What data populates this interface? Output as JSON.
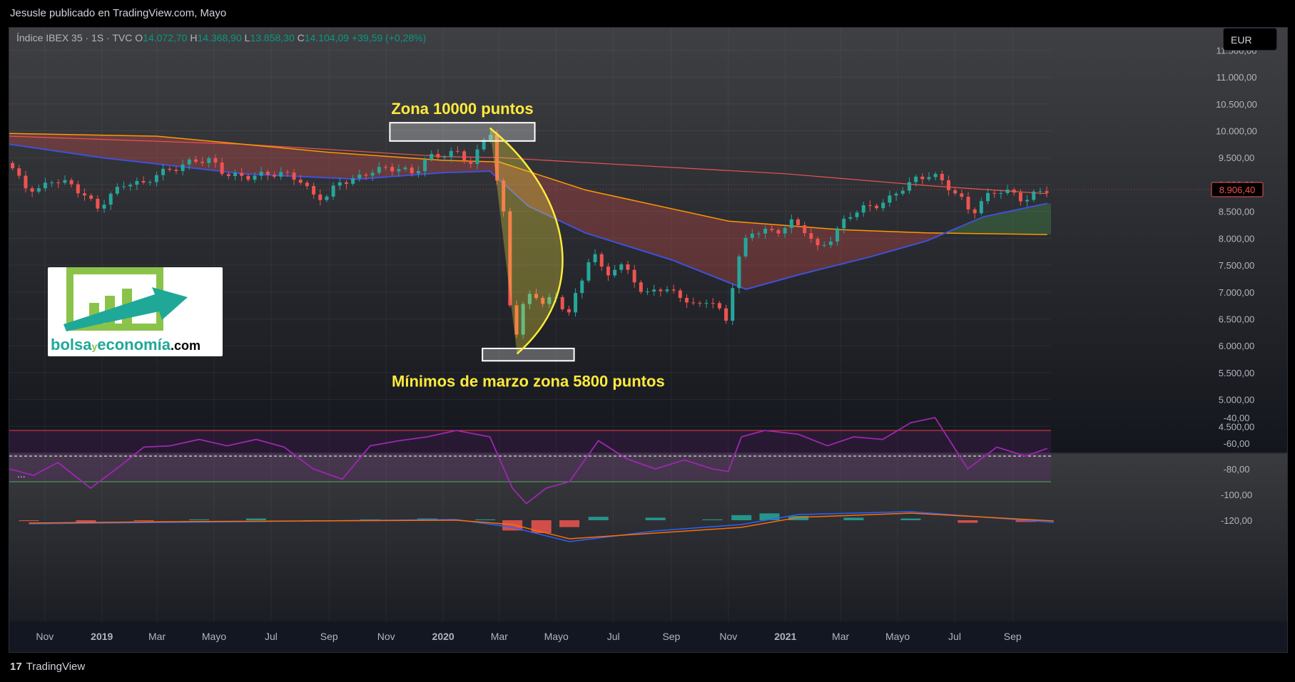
{
  "header": {
    "attribution": "Jesusle publicado en TradingView.com, Mayo"
  },
  "legend": {
    "symbol": "Índice IBEX 35 · 1S · TVC",
    "o_label": "O",
    "o_value": "14.072,70",
    "h_label": "H",
    "h_value": "14.368,90",
    "l_label": "L",
    "l_value": "13.858,30",
    "c_label": "C",
    "c_value": "14.104,09",
    "change": "+39,59 (+0,28%)"
  },
  "currency": "EUR",
  "indicator_pane_label": "...",
  "footer": {
    "brand": "TradingView",
    "brand_icon": "tradingview-logo-icon"
  },
  "logo": {
    "text_main": "bolsa",
    "text_y": "y",
    "text_econ": "economía",
    "text_com": ".com",
    "icon": "rising-chart-arrow-icon"
  },
  "colors": {
    "bg_top": "#3f4043",
    "bg_bottom": "#131722",
    "up": "#26a69a",
    "down": "#ef5350",
    "sma_red": "#ef5350",
    "sma_orange": "#ff9800",
    "ema_blue": "#3f51d8",
    "annotation": "#ffeb3b",
    "rsi": "#9c27b0",
    "macd_line": "#2962ff",
    "signal_line": "#ff6d00"
  },
  "chart_data": {
    "type": "candlestick",
    "price_axis": {
      "ticks": [
        "11.500,00",
        "11.000,00",
        "10.500,00",
        "10.000,00",
        "9.500,00",
        "9.000,00",
        "8.500,00",
        "8.000,00",
        "7.500,00",
        "7.000,00",
        "6.500,00",
        "6.000,00",
        "5.500,00",
        "5.000,00",
        "4.500,00"
      ],
      "tick_values": [
        11500,
        11000,
        10500,
        10000,
        9500,
        9000,
        8500,
        8000,
        7500,
        7000,
        6500,
        6000,
        5500,
        5000,
        4500
      ],
      "last_price_label": "8.906,40",
      "last_price": 8906.4
    },
    "time_axis": {
      "labels": [
        "Nov",
        "2019",
        "Mar",
        "Mayo",
        "Jul",
        "Sep",
        "Nov",
        "2020",
        "Mar",
        "Mayo",
        "Jul",
        "Sep",
        "Nov",
        "2021",
        "Mar",
        "Mayo",
        "Jul",
        "Sep"
      ],
      "bold": [
        false,
        true,
        false,
        false,
        false,
        false,
        false,
        true,
        false,
        false,
        false,
        false,
        false,
        true,
        false,
        false,
        false,
        false
      ],
      "months": [
        "2018-11",
        "2019-01",
        "2019-03",
        "2019-05",
        "2019-07",
        "2019-09",
        "2019-11",
        "2020-01",
        "2020-03",
        "2020-05",
        "2020-07",
        "2020-09",
        "2020-11",
        "2021-01",
        "2021-03",
        "2021-05",
        "2021-07",
        "2021-09"
      ]
    },
    "close_path": [
      [
        "2018-09-24",
        9400
      ],
      [
        "2018-10-10",
        8950
      ],
      [
        "2018-10-26",
        8900
      ],
      [
        "2018-11-10",
        9100
      ],
      [
        "2018-11-28",
        9000
      ],
      [
        "2018-12-14",
        8800
      ],
      [
        "2018-12-27",
        8550
      ],
      [
        "2019-01-10",
        8800
      ],
      [
        "2019-01-28",
        9050
      ],
      [
        "2019-02-14",
        9000
      ],
      [
        "2019-03-01",
        9200
      ],
      [
        "2019-03-20",
        9300
      ],
      [
        "2019-04-10",
        9450
      ],
      [
        "2019-04-28",
        9450
      ],
      [
        "2019-05-12",
        9200
      ],
      [
        "2019-05-26",
        9150
      ],
      [
        "2019-06-10",
        9150
      ],
      [
        "2019-06-28",
        9200
      ],
      [
        "2019-07-15",
        9200
      ],
      [
        "2019-07-31",
        9100
      ],
      [
        "2019-08-14",
        8800
      ],
      [
        "2019-08-28",
        8750
      ],
      [
        "2019-09-12",
        9050
      ],
      [
        "2019-09-30",
        9100
      ],
      [
        "2019-10-15",
        9250
      ],
      [
        "2019-10-31",
        9300
      ],
      [
        "2019-11-15",
        9300
      ],
      [
        "2019-11-30",
        9200
      ],
      [
        "2019-12-15",
        9500
      ],
      [
        "2019-12-31",
        9550
      ],
      [
        "2020-01-15",
        9600
      ],
      [
        "2020-01-31",
        9400
      ],
      [
        "2020-02-10",
        9700
      ],
      [
        "2020-02-20",
        10050
      ],
      [
        "2020-02-28",
        9000
      ],
      [
        "2020-03-06",
        8400
      ],
      [
        "2020-03-13",
        6650
      ],
      [
        "2020-03-20",
        6230
      ],
      [
        "2020-03-27",
        6780
      ],
      [
        "2020-04-06",
        7000
      ],
      [
        "2020-04-17",
        6800
      ],
      [
        "2020-04-30",
        6900
      ],
      [
        "2020-05-14",
        6600
      ],
      [
        "2020-05-28",
        7200
      ],
      [
        "2020-06-08",
        7800
      ],
      [
        "2020-06-22",
        7300
      ],
      [
        "2020-07-06",
        7500
      ],
      [
        "2020-07-20",
        7350
      ],
      [
        "2020-08-03",
        6900
      ],
      [
        "2020-08-17",
        7100
      ],
      [
        "2020-08-31",
        7000
      ],
      [
        "2020-09-14",
        6900
      ],
      [
        "2020-09-28",
        6700
      ],
      [
        "2020-10-12",
        6900
      ],
      [
        "2020-10-30",
        6450
      ],
      [
        "2020-11-09",
        7500
      ],
      [
        "2020-11-23",
        8100
      ],
      [
        "2020-12-07",
        8150
      ],
      [
        "2020-12-21",
        8100
      ],
      [
        "2021-01-08",
        8300
      ],
      [
        "2021-01-22",
        8150
      ],
      [
        "2021-02-05",
        7800
      ],
      [
        "2021-02-19",
        8000
      ],
      [
        "2021-03-08",
        8400
      ],
      [
        "2021-03-22",
        8550
      ],
      [
        "2021-04-06",
        8600
      ],
      [
        "2021-04-20",
        8700
      ],
      [
        "2021-05-07",
        8950
      ],
      [
        "2021-05-21",
        9100
      ],
      [
        "2021-06-07",
        9200
      ],
      [
        "2021-06-21",
        9000
      ],
      [
        "2021-07-05",
        8800
      ],
      [
        "2021-07-19",
        8450
      ],
      [
        "2021-08-02",
        8750
      ],
      [
        "2021-08-16",
        8900
      ],
      [
        "2021-08-30",
        8850
      ],
      [
        "2021-09-13",
        8700
      ],
      [
        "2021-09-27",
        8850
      ],
      [
        "2021-10-08",
        8906.4
      ]
    ],
    "overlays": [
      {
        "name": "SMA 200 (red)",
        "points": [
          [
            "2018-09-24",
            9900
          ],
          [
            "2019-06-01",
            9750
          ],
          [
            "2020-01-01",
            9520
          ],
          [
            "2020-03-01",
            9500
          ],
          [
            "2020-07-01",
            9380
          ],
          [
            "2021-01-01",
            9200
          ],
          [
            "2021-06-01",
            8980
          ],
          [
            "2021-10-08",
            8830
          ]
        ]
      },
      {
        "name": "SMA (orange)",
        "points": [
          [
            "2018-09-24",
            9950
          ],
          [
            "2019-03-01",
            9900
          ],
          [
            "2019-09-01",
            9600
          ],
          [
            "2020-01-01",
            9450
          ],
          [
            "2020-03-01",
            9420
          ],
          [
            "2020-06-01",
            8900
          ],
          [
            "2020-11-01",
            8320
          ],
          [
            "2021-03-01",
            8160
          ],
          [
            "2021-06-01",
            8100
          ],
          [
            "2021-10-08",
            8070
          ]
        ]
      },
      {
        "name": "EMA (blue)",
        "points": [
          [
            "2018-09-24",
            9750
          ],
          [
            "2019-01-01",
            9500
          ],
          [
            "2019-06-01",
            9200
          ],
          [
            "2019-10-01",
            9100
          ],
          [
            "2020-01-01",
            9220
          ],
          [
            "2020-02-20",
            9250
          ],
          [
            "2020-04-01",
            8600
          ],
          [
            "2020-06-01",
            8100
          ],
          [
            "2020-09-01",
            7600
          ],
          [
            "2020-11-20",
            7050
          ],
          [
            "2021-01-15",
            7320
          ],
          [
            "2021-04-01",
            7650
          ],
          [
            "2021-06-01",
            7950
          ],
          [
            "2021-08-01",
            8400
          ],
          [
            "2021-10-08",
            8650
          ]
        ]
      }
    ],
    "annotations": [
      {
        "text": "Zona 10000 puntos",
        "box_price": [
          10150,
          9810
        ],
        "box_dates": [
          "2019-11-05",
          "2020-04-08"
        ]
      },
      {
        "text": "Mínimos de marzo zona 5800 puntos",
        "box_price": [
          5950,
          5720
        ],
        "box_dates": [
          "2020-02-12",
          "2020-05-20"
        ]
      }
    ],
    "rsi": {
      "axis_ticks": [
        "-40,00",
        "-60,00",
        "-80,00",
        "-100,00",
        "-120,00"
      ],
      "tick_values": [
        -40,
        -60,
        -80,
        -100,
        -120
      ],
      "upper_band": -50,
      "lower_band": -90,
      "mid": -70,
      "series": [
        [
          "2018-09-24",
          -80
        ],
        [
          "2018-10-20",
          -85
        ],
        [
          "2018-11-15",
          -75
        ],
        [
          "2018-12-20",
          -95
        ],
        [
          "2019-01-20",
          -78
        ],
        [
          "2019-02-15",
          -63
        ],
        [
          "2019-03-15",
          -62
        ],
        [
          "2019-04-15",
          -57
        ],
        [
          "2019-05-15",
          -62
        ],
        [
          "2019-06-15",
          -57
        ],
        [
          "2019-07-15",
          -63
        ],
        [
          "2019-08-15",
          -80
        ],
        [
          "2019-09-15",
          -88
        ],
        [
          "2019-10-15",
          -62
        ],
        [
          "2019-11-15",
          -58
        ],
        [
          "2019-12-15",
          -55
        ],
        [
          "2020-01-15",
          -50
        ],
        [
          "2020-02-20",
          -55
        ],
        [
          "2020-03-15",
          -95
        ],
        [
          "2020-03-30",
          -107
        ],
        [
          "2020-04-20",
          -95
        ],
        [
          "2020-05-15",
          -90
        ],
        [
          "2020-06-15",
          -58
        ],
        [
          "2020-07-15",
          -72
        ],
        [
          "2020-08-15",
          -80
        ],
        [
          "2020-09-15",
          -73
        ],
        [
          "2020-10-15",
          -80
        ],
        [
          "2020-11-01",
          -82
        ],
        [
          "2020-11-15",
          -55
        ],
        [
          "2020-12-10",
          -50
        ],
        [
          "2021-01-15",
          -53
        ],
        [
          "2021-02-15",
          -62
        ],
        [
          "2021-03-15",
          -55
        ],
        [
          "2021-04-15",
          -57
        ],
        [
          "2021-05-15",
          -44
        ],
        [
          "2021-06-10",
          -40
        ],
        [
          "2021-07-15",
          -80
        ],
        [
          "2021-08-15",
          -63
        ],
        [
          "2021-09-15",
          -70
        ],
        [
          "2021-10-08",
          -64
        ]
      ]
    },
    "macd": {
      "histogram": [
        [
          "2018-10",
          -1
        ],
        [
          "2018-12",
          -2
        ],
        [
          "2019-02",
          -1
        ],
        [
          "2019-04",
          1
        ],
        [
          "2019-06",
          2
        ],
        [
          "2019-08",
          -1
        ],
        [
          "2019-10",
          1
        ],
        [
          "2019-12",
          2
        ],
        [
          "2020-02",
          1
        ],
        [
          "2020-03",
          -12
        ],
        [
          "2020-04",
          -15
        ],
        [
          "2020-05",
          -8
        ],
        [
          "2020-06",
          4
        ],
        [
          "2020-08",
          3
        ],
        [
          "2020-10",
          1
        ],
        [
          "2020-11",
          6
        ],
        [
          "2020-12",
          8
        ],
        [
          "2021-01",
          5
        ],
        [
          "2021-03",
          3
        ],
        [
          "2021-05",
          2
        ],
        [
          "2021-07",
          -3
        ],
        [
          "2021-09",
          -2
        ]
      ],
      "macd_line": [
        [
          "2018-10",
          -5
        ],
        [
          "2019-03",
          -3
        ],
        [
          "2020-01",
          1
        ],
        [
          "2020-03",
          -10
        ],
        [
          "2020-05",
          -30
        ],
        [
          "2020-08",
          -15
        ],
        [
          "2020-11",
          -6
        ],
        [
          "2021-01",
          8
        ],
        [
          "2021-05",
          12
        ],
        [
          "2021-10",
          -3
        ]
      ],
      "signal_line": [
        [
          "2018-10",
          -4
        ],
        [
          "2019-03",
          -2
        ],
        [
          "2020-01",
          0
        ],
        [
          "2020-03",
          -6
        ],
        [
          "2020-05",
          -26
        ],
        [
          "2020-08",
          -18
        ],
        [
          "2020-11",
          -10
        ],
        [
          "2021-01",
          4
        ],
        [
          "2021-05",
          10
        ],
        [
          "2021-10",
          -1
        ]
      ]
    }
  }
}
